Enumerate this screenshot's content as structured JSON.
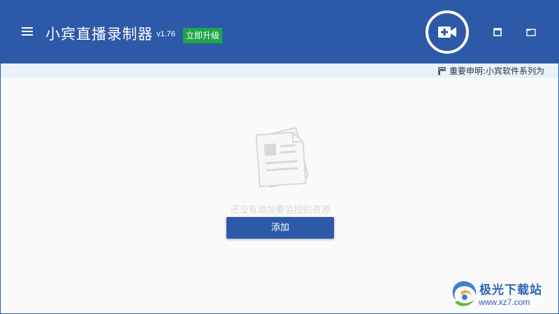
{
  "header": {
    "menu_icon": "hamburger-menu-icon",
    "title": "小宾直播录制器",
    "version": "v1.76",
    "upgrade_label": "立即升级",
    "record_icon": "video-add-icon",
    "minimize_icon": "window-square-icon",
    "maximize_icon": "window-restore-icon",
    "colors": {
      "header_bg": "#2c5aa8",
      "upgrade_bg": "#1fa54a"
    }
  },
  "notice": {
    "icon": "document-icon",
    "text": "重要申明:小宾软件系列为"
  },
  "empty_state": {
    "illustration": "documents-icon",
    "message": "还没有添加要监控的资源",
    "add_label": "添加"
  },
  "watermark": {
    "logo": "xz7-logo-icon",
    "site_name": "极光下载站",
    "url": "www.xz7.com"
  }
}
